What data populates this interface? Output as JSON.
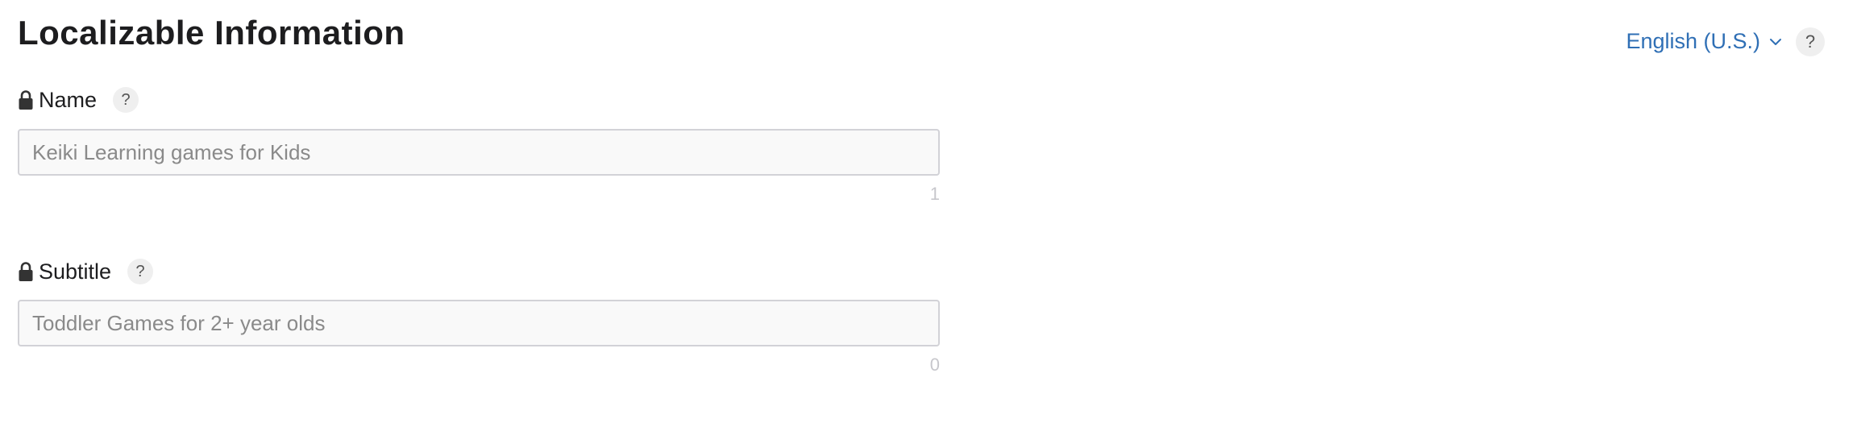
{
  "section": {
    "title": "Localizable Information",
    "locale_label": "English (U.S.)",
    "help_label": "?"
  },
  "fields": [
    {
      "label": "Name",
      "help_label": "?",
      "value": "Keiki Learning games for Kids",
      "char_count": "1"
    },
    {
      "label": "Subtitle",
      "help_label": "?",
      "value": "Toddler Games for 2+ year olds",
      "char_count": "0"
    }
  ],
  "colors": {
    "link": "#2f6fb5",
    "input_border": "#d2d2d7",
    "input_bg": "#f9f9f9"
  },
  "icons": {
    "locked": "lock-icon",
    "dropdown": "chevron-down-icon",
    "help": "help-icon"
  }
}
